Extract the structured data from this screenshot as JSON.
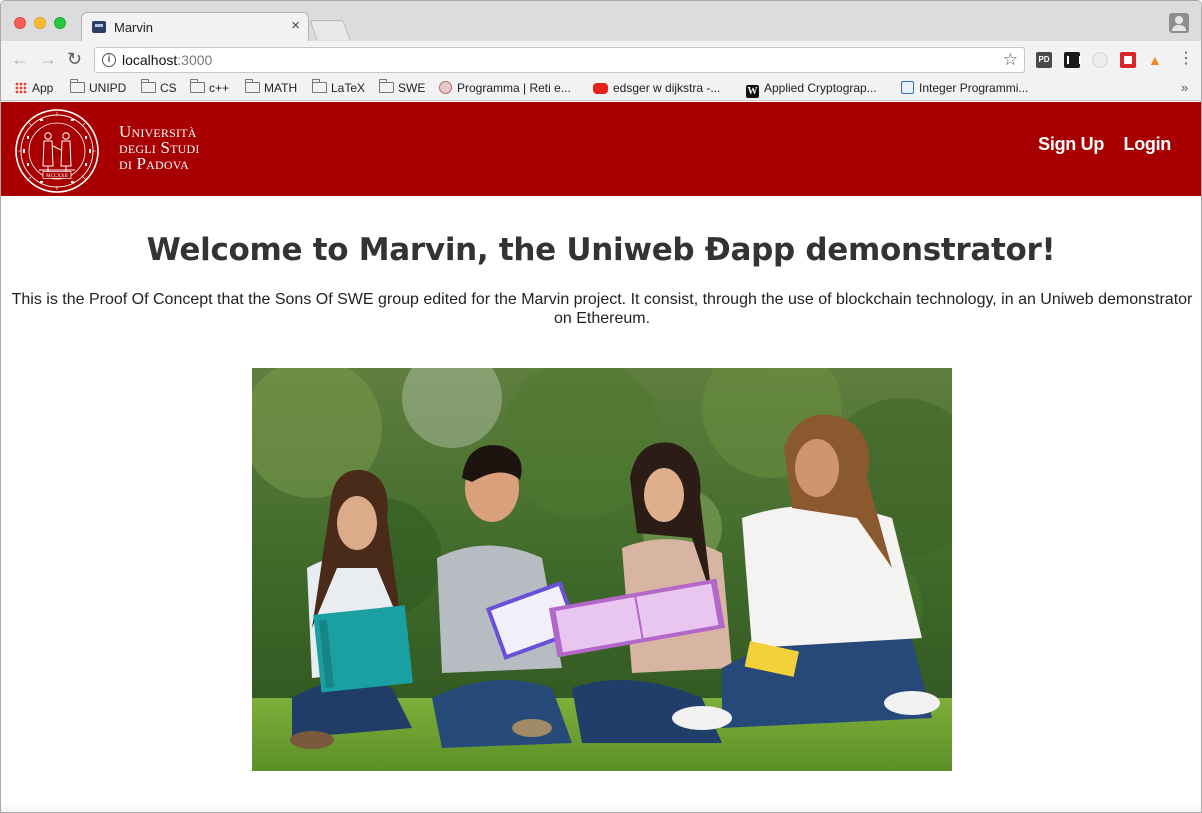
{
  "browser": {
    "tab_title": "Marvin",
    "tab_close": "×",
    "url_host": "localhost",
    "url_port": ":3000",
    "extensions": {
      "pd_label": "PD"
    },
    "bookmarks": [
      {
        "label": "App",
        "icon": "apps-grid-icon"
      },
      {
        "label": "UNIPD",
        "icon": "folder-icon"
      },
      {
        "label": "CS",
        "icon": "folder-icon"
      },
      {
        "label": "c++",
        "icon": "folder-icon"
      },
      {
        "label": "MATH",
        "icon": "folder-icon"
      },
      {
        "label": "LaTeX",
        "icon": "folder-icon"
      },
      {
        "label": "SWE",
        "icon": "folder-icon"
      },
      {
        "label": "Programma | Reti e...",
        "icon": "unipd-seal-icon"
      },
      {
        "label": "edsger w dijkstra -...",
        "icon": "youtube-icon"
      },
      {
        "label": "Applied Cryptograp...",
        "icon": "wikipedia-icon"
      },
      {
        "label": "Integer Programmi...",
        "icon": "document-icon"
      }
    ],
    "bookmarks_more": "»"
  },
  "site": {
    "brand_color": "#a80000",
    "university": {
      "line1": "Università",
      "line2": "degli Studi",
      "line3": "di Padova",
      "seal_text": "MCCXXII"
    },
    "nav": {
      "signup": "Sign Up",
      "login": "Login"
    },
    "welcome_title": "Welcome to Marvin, the Uniweb Ðapp demonstrator!",
    "intro_text": "This is the Proof Of Concept that the Sons Of SWE group edited for the Marvin project. It consist, through the use of blockchain technology, in an Uniweb demonstrator on Ethereum."
  }
}
